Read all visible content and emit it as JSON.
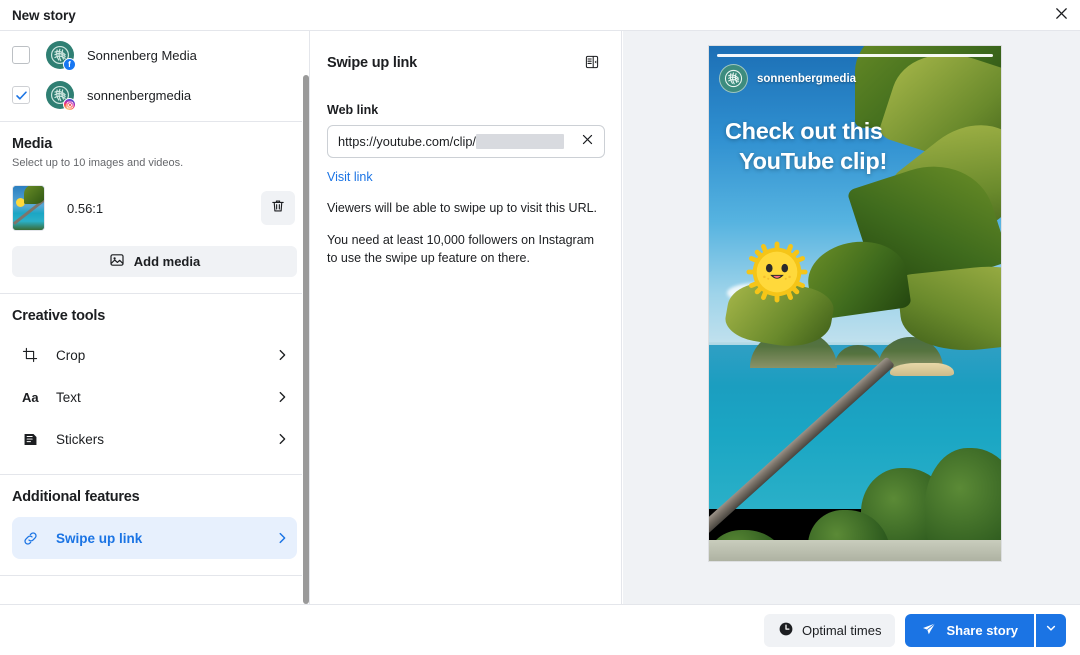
{
  "window": {
    "title": "New story",
    "close_icon": "close-icon"
  },
  "accounts": {
    "items": [
      {
        "name": "Sonnenberg Media",
        "platform": "facebook",
        "checked": false,
        "avatar_icon": "knot-logo-icon"
      },
      {
        "name": "sonnenbergmedia",
        "platform": "instagram",
        "checked": true,
        "avatar_icon": "knot-logo-icon"
      }
    ]
  },
  "media": {
    "title": "Media",
    "subtitle": "Select up to 10 images and videos.",
    "items": [
      {
        "ratio": "0.56:1",
        "delete_icon": "trash-icon"
      }
    ],
    "add_button_label": "Add media",
    "add_button_icon": "image-icon"
  },
  "creative_tools": {
    "title": "Creative tools",
    "items": [
      {
        "label": "Crop",
        "icon": "crop-icon"
      },
      {
        "label": "Text",
        "icon": "text-aa-icon"
      },
      {
        "label": "Stickers",
        "icon": "sticker-icon"
      }
    ],
    "chevron_icon": "chevron-right-icon"
  },
  "additional_features": {
    "title": "Additional features",
    "items": [
      {
        "label": "Swipe up link",
        "icon": "link-icon",
        "selected": true
      }
    ],
    "chevron_icon": "chevron-right-icon"
  },
  "swipe_up_panel": {
    "title": "Swipe up link",
    "panel_toggle_icon": "panel-layout-icon",
    "field_label": "Web link",
    "url_visible": "https://youtube.com/clip/",
    "url_redacted": true,
    "clear_icon": "close-icon",
    "visit_link_label": "Visit link",
    "help_line_1": "Viewers will be able to swipe up to visit this URL.",
    "help_line_2": "You need at least 10,000 followers on Instagram to use the swipe up feature on there."
  },
  "preview": {
    "handle": "sonnenbergmedia",
    "avatar_icon": "knot-logo-icon",
    "headline_line_1": "Check out this",
    "headline_line_2": "YouTube clip!",
    "sticker_icon": "smiling-sun-sticker",
    "scene": "tropical beach with leaning palm tree, turquoise ocean and distant islands"
  },
  "footer": {
    "optimal_times_label": "Optimal times",
    "optimal_times_icon": "clock-icon",
    "share_label": "Share story",
    "share_icon": "send-icon",
    "share_caret_icon": "chevron-down-icon"
  },
  "colors": {
    "accent_blue": "#1b74e4",
    "link_blue": "#1b74e4",
    "selected_bg": "#e7f0fd",
    "panel_bg": "#f0f2f5",
    "text_primary": "#1c1e21",
    "text_secondary": "#65676b",
    "border": "#e4e6eb",
    "avatar_teal": "#2f7f73"
  }
}
